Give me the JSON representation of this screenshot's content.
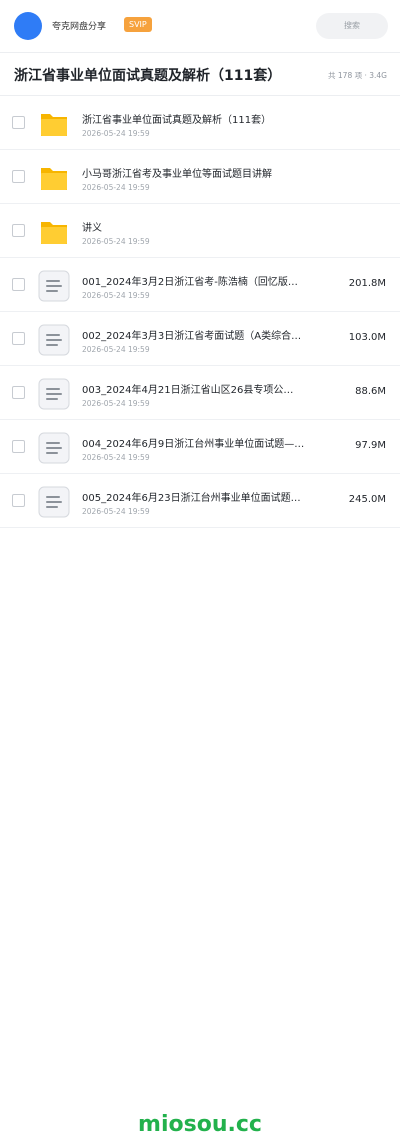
{
  "header": {
    "sharer_name": "夸克网盘分享",
    "badge": "SVIP",
    "search_placeholder": "搜索",
    "brand_color": "#2f7cf6"
  },
  "folder": {
    "title": "浙江省事业单位面试真题及解析（111套）",
    "meta": "共 178 项 · 3.4G"
  },
  "files": [
    {
      "type": "folder",
      "icon": "folder-icon",
      "name": "浙江省事业单位面试真题及解析（111套）",
      "date": "2026-05-24 19:59",
      "size": ""
    },
    {
      "type": "folder",
      "icon": "folder-icon",
      "name": "小马哥浙江省考及事业单位等面试题目讲解",
      "date": "2026-05-24 19:59",
      "size": ""
    },
    {
      "type": "folder",
      "icon": "folder-icon",
      "name": "讲义",
      "date": "2026-05-24 19:59",
      "size": ""
    },
    {
      "type": "file",
      "icon": "document-icon",
      "name": "001_2024年3月2日浙江省考-陈浩楠（回忆版…",
      "date": "2026-05-24 19:59",
      "size": "201.8M"
    },
    {
      "type": "file",
      "icon": "document-icon",
      "name": "002_2024年3月3日浙江省考面试题（A类综合…",
      "date": "2026-05-24 19:59",
      "size": "103.0M"
    },
    {
      "type": "file",
      "icon": "document-icon",
      "name": "003_2024年4月21日浙江省山区26县专项公…",
      "date": "2026-05-24 19:59",
      "size": "88.6M"
    },
    {
      "type": "file",
      "icon": "document-icon",
      "name": "004_2024年6月9日浙江台州事业单位面试题—…",
      "date": "2026-05-24 19:59",
      "size": "97.9M"
    },
    {
      "type": "file",
      "icon": "document-icon",
      "name": "005_2024年6月23日浙江台州事业单位面试题…",
      "date": "2026-05-24 19:59",
      "size": "245.0M"
    }
  ],
  "watermark": "miosou.cc"
}
